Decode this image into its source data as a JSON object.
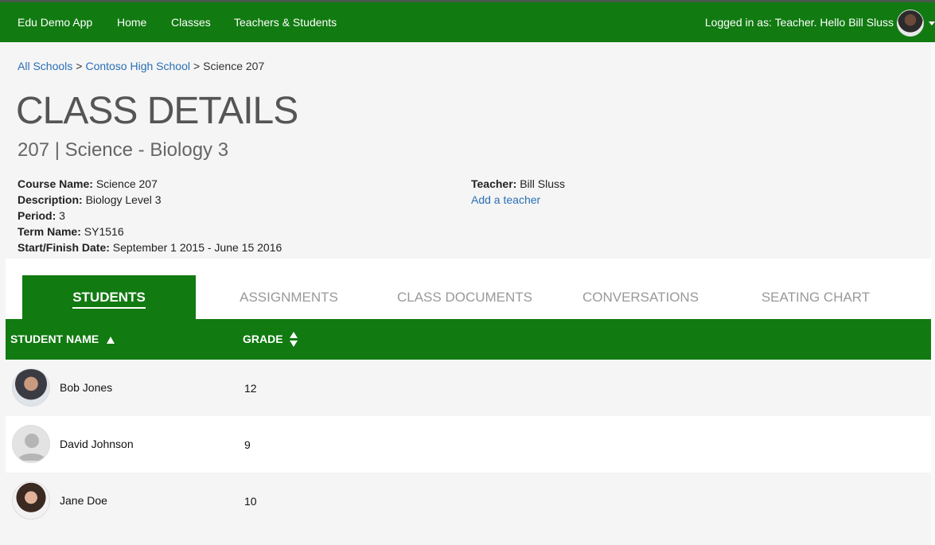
{
  "nav": {
    "brand": "Edu Demo App",
    "items": [
      "Home",
      "Classes",
      "Teachers & Students"
    ],
    "login_text": "Logged in as: Teacher. Hello Bill Sluss"
  },
  "breadcrumb": {
    "items": [
      "All Schools",
      "Contoso High School"
    ],
    "separator": ">",
    "current": "Science 207"
  },
  "page": {
    "title": "CLASS DETAILS",
    "subtitle": "207 | Science - Biology 3"
  },
  "details": {
    "left": [
      {
        "label": "Course Name:",
        "value": "Science 207"
      },
      {
        "label": "Description:",
        "value": "Biology Level 3"
      },
      {
        "label": "Period:",
        "value": "3"
      },
      {
        "label": "Term Name:",
        "value": "SY1516"
      },
      {
        "label": "Start/Finish Date:",
        "value": "September 1 2015 - June 15 2016"
      }
    ],
    "teacher_label": "Teacher:",
    "teacher_value": "Bill Sluss",
    "add_teacher": "Add a teacher"
  },
  "tabs": [
    "STUDENTS",
    "ASSIGNMENTS",
    "CLASS DOCUMENTS",
    "CONVERSATIONS",
    "SEATING CHART"
  ],
  "table": {
    "columns": [
      "STUDENT NAME",
      "GRADE"
    ],
    "rows": [
      {
        "name": "Bob Jones",
        "grade": "12"
      },
      {
        "name": "David Johnson",
        "grade": "9"
      },
      {
        "name": "Jane Doe",
        "grade": "10"
      }
    ]
  },
  "colors": {
    "brand_green": "#117a11",
    "link_blue": "#2a6fb5"
  }
}
